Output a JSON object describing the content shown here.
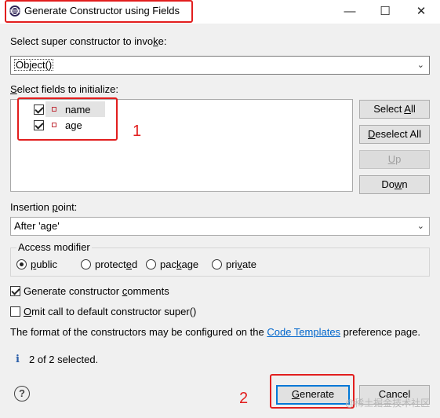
{
  "window": {
    "title": "Generate Constructor using Fields",
    "controls": {
      "minimize": "—",
      "maximize": "☐",
      "close": "✕"
    }
  },
  "super_constructor": {
    "label_pre": "Select super constructor to invo",
    "label_mnemonic": "k",
    "label_post": "e:",
    "selected": "Object()"
  },
  "fields": {
    "label_mnemonic": "S",
    "label_rest": "elect fields to initialize:",
    "items": [
      {
        "name": "name",
        "checked": true
      },
      {
        "name": "age",
        "checked": true
      }
    ]
  },
  "side_buttons": {
    "select_all_pre": "Select ",
    "select_all_mnemonic": "A",
    "select_all_post": "ll",
    "deselect_all_mnemonic": "D",
    "deselect_all_rest": "eselect All",
    "up_mnemonic": "U",
    "up_rest": "p",
    "down_pre": "Do",
    "down_mnemonic": "w",
    "down_post": "n"
  },
  "insertion_point": {
    "label_pre": "Insertion ",
    "label_mnemonic": "p",
    "label_post": "oint:",
    "selected": "After 'age'"
  },
  "access_modifier": {
    "title": "Access modifier",
    "options": [
      {
        "pre": "",
        "mnemonic": "p",
        "post": "ublic",
        "selected": true
      },
      {
        "pre": "protect",
        "mnemonic": "e",
        "post": "d",
        "selected": false
      },
      {
        "pre": "pac",
        "mnemonic": "k",
        "post": "age",
        "selected": false
      },
      {
        "pre": "pri",
        "mnemonic": "v",
        "post": "ate",
        "selected": false
      }
    ]
  },
  "options": {
    "generate_comments_pre": "Generate constructor ",
    "generate_comments_mnemonic": "c",
    "generate_comments_post": "omments",
    "generate_comments_checked": true,
    "omit_call_mnemonic": "O",
    "omit_call_rest": "mit call to default constructor super()",
    "omit_call_checked": false
  },
  "info": {
    "text_pre": "The format of the constructors may be configured on the ",
    "link": "Code Templates",
    "text_post": " preference page.",
    "status_icon": "i",
    "status": "2 of 2 selected."
  },
  "footer": {
    "help": "?",
    "generate_mnemonic": "G",
    "generate_rest": "enerate",
    "cancel": "Cancel",
    "watermark": "@稀土掘金技术社区"
  },
  "annotations": {
    "one": "1",
    "two": "2"
  },
  "colors": {
    "annotation": "#e21e1e",
    "link": "#0066cc",
    "default_button": "#0078d7"
  }
}
